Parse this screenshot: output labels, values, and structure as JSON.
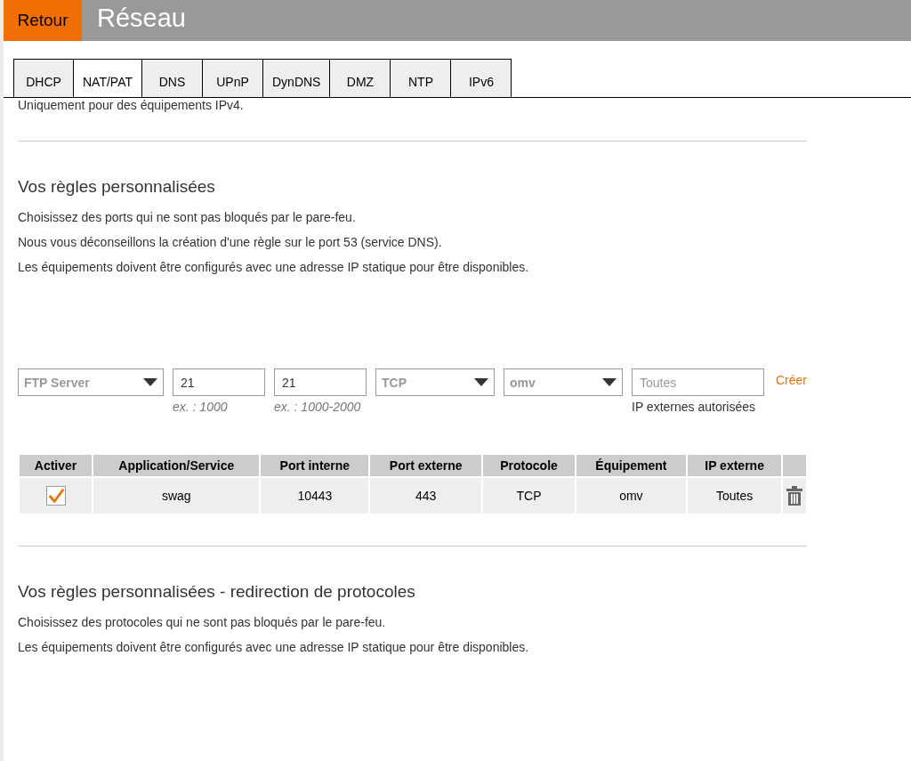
{
  "header": {
    "back_button": "Retour",
    "title": "Réseau"
  },
  "tabs": [
    {
      "label": "DHCP",
      "selected": false
    },
    {
      "label": "NAT/PAT",
      "selected": true
    },
    {
      "label": "DNS",
      "selected": false
    },
    {
      "label": "UPnP",
      "selected": false
    },
    {
      "label": "DynDNS",
      "selected": false
    },
    {
      "label": "DMZ",
      "selected": false
    },
    {
      "label": "NTP",
      "selected": false
    },
    {
      "label": "IPv6",
      "selected": false
    }
  ],
  "intro_note": "Uniquement pour des équipements IPv4.",
  "custom_rules": {
    "title": "Vos règles personnalisées",
    "paragraphs": [
      "Choisissez des ports qui ne sont pas bloqués par le pare-feu.",
      "Nous vous déconseillons la création d'une règle sur le port 53 (service DNS).",
      "Les équipements doivent être configurés avec une adresse IP statique pour être disponibles."
    ],
    "form": {
      "fields": [
        {
          "kind": "select",
          "value": "FTP Server"
        },
        {
          "kind": "input",
          "value": "21",
          "hint": "ex. : 1000"
        },
        {
          "kind": "input",
          "value": "21",
          "hint": "ex. : 1000-2000"
        },
        {
          "kind": "select",
          "value": "TCP"
        },
        {
          "kind": "select",
          "value": "omv"
        },
        {
          "kind": "input",
          "placeholder": "Toutes",
          "note": "IP externes autorisées"
        }
      ],
      "create_link": "Créer"
    },
    "table": {
      "columns": [
        "Activer",
        "Application/Service",
        "Port interne",
        "Port externe",
        "Protocole",
        "Équipement",
        "IP externe"
      ],
      "rows": [
        {
          "checked": true,
          "cells": [
            "",
            "swag",
            "10443",
            "443",
            "TCP",
            "omv",
            "Toutes"
          ]
        }
      ]
    }
  },
  "protocol_rules": {
    "title": "Vos règles personnalisées - redirection de protocoles",
    "paragraphs": [
      "Choisissez des protocoles qui ne sont pas bloqués par le pare-feu.",
      "Les équipements doivent être configurés avec une adresse IP statique pour être disponibles."
    ]
  }
}
